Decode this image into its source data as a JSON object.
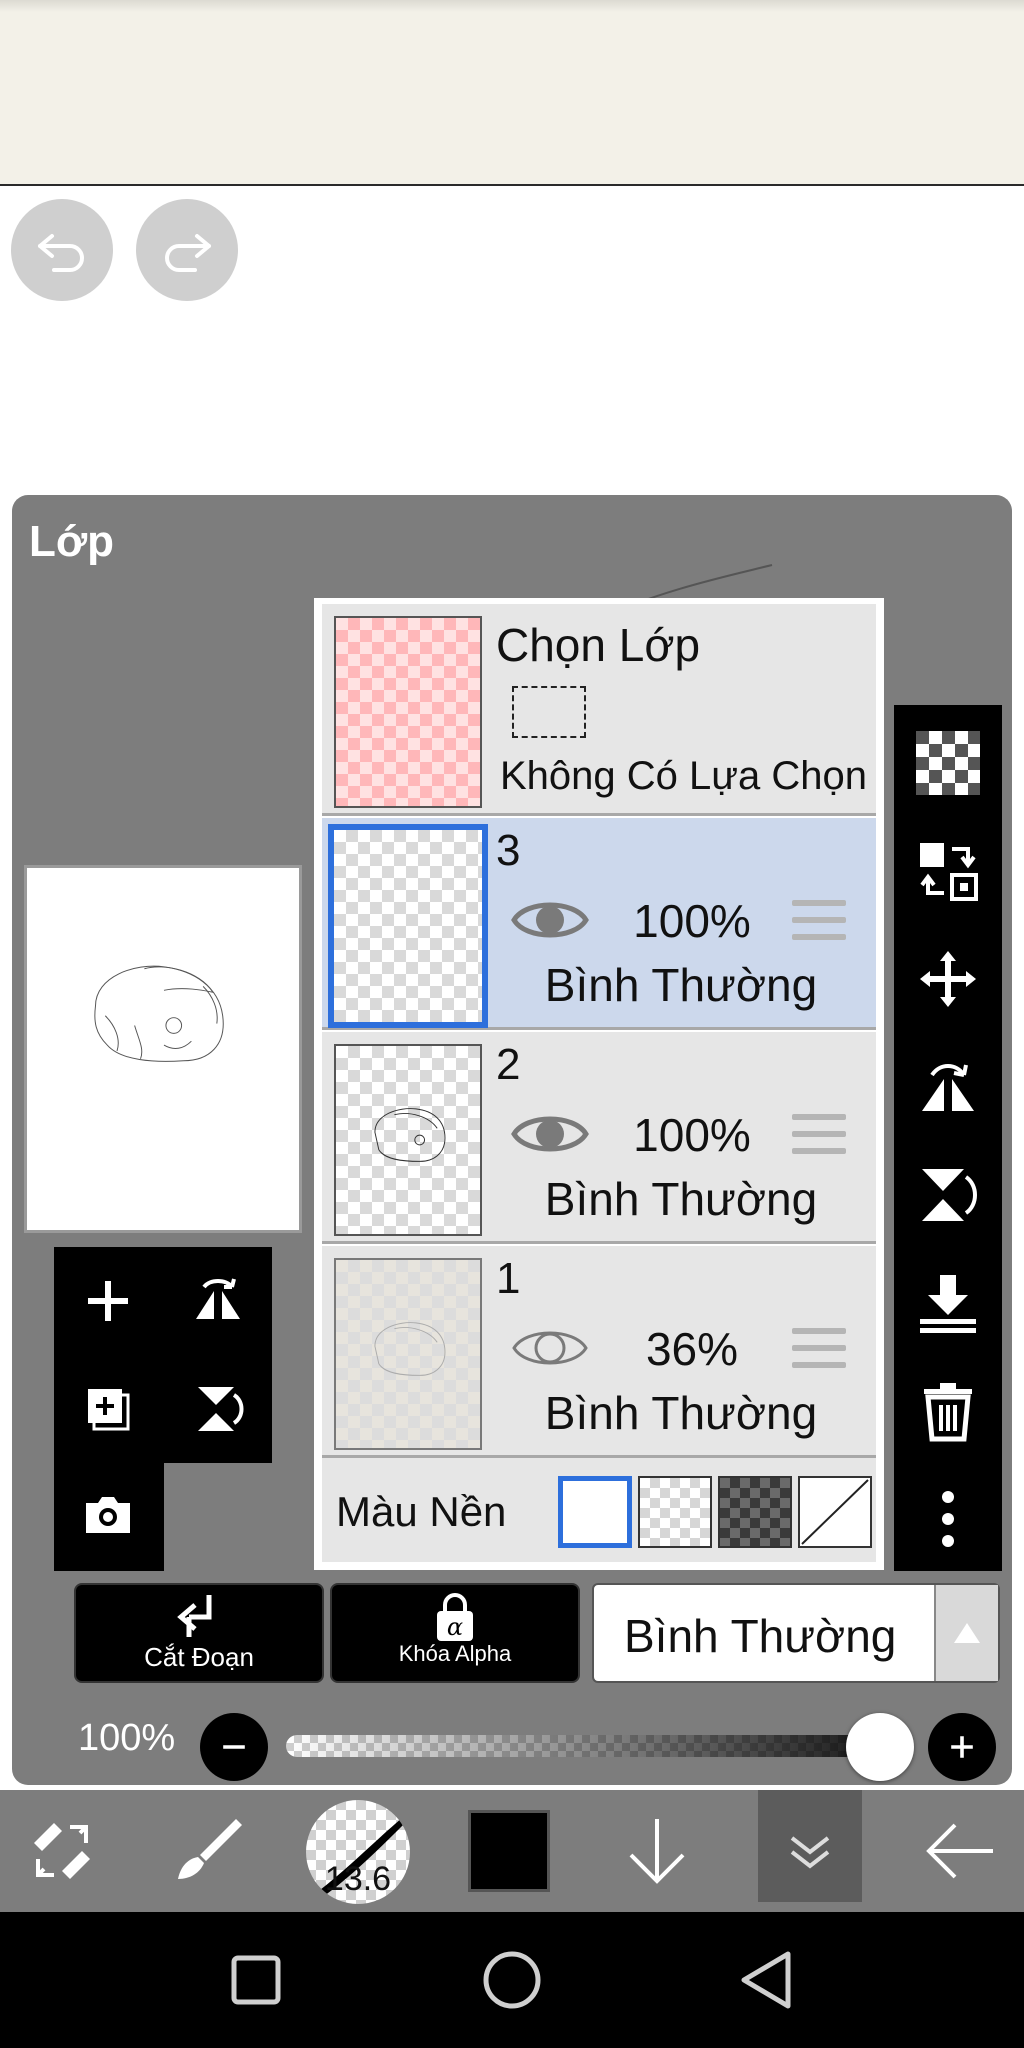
{
  "panel": {
    "title": "Lớp"
  },
  "selection_layer": {
    "title": "Chọn Lớp",
    "status": "Không Có Lựa Chọn"
  },
  "layers": [
    {
      "number": "3",
      "opacity": "100%",
      "blend": "Bình Thường",
      "visible": true,
      "selected": true
    },
    {
      "number": "2",
      "opacity": "100%",
      "blend": "Bình Thường",
      "visible": true,
      "selected": false
    },
    {
      "number": "1",
      "opacity": "36%",
      "blend": "Bình Thường",
      "visible": false,
      "selected": false
    }
  ],
  "background": {
    "label": "Màu Nền",
    "options": [
      "white",
      "checker-light",
      "checker-dark",
      "none"
    ],
    "selected": "white"
  },
  "buttons": {
    "clipping": "Cắt Đoạn",
    "alpha_lock": "Khóa Alpha",
    "alpha_glyph": "α"
  },
  "blend_mode": {
    "value": "Bình Thường"
  },
  "opacity_control": {
    "label": "100%",
    "value": 1.0
  },
  "bottom_toolbar": {
    "brush_size": "13.6",
    "current_color": "#000000"
  },
  "colors": {
    "selection_accent": "#2d6fdc",
    "panel_bg": "#7d7d7d",
    "selected_row": "#ccd8ec"
  }
}
